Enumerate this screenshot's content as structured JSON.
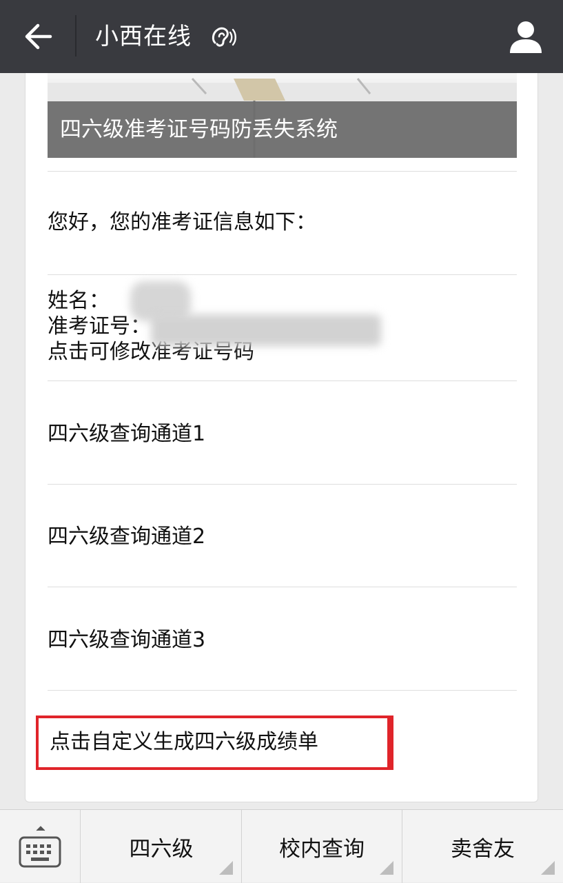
{
  "header": {
    "title": "小西在线",
    "back_icon": "arrow-left-icon",
    "listen_icon": "ear-icon",
    "profile_icon": "person-icon"
  },
  "banner": {
    "title": "四六级准考证号码防丢失系统"
  },
  "content": {
    "greeting": "您好，您的准考证信息如下：",
    "name_label": "姓名：",
    "ticket_label": "准考证号：",
    "edit_link": "点击可修改准考证号码",
    "channels": [
      {
        "label": "四六级查询通道1"
      },
      {
        "label": "四六级查询通道2"
      },
      {
        "label": "四六级查询通道3"
      }
    ],
    "custom_report": "点击自定义生成四六级成绩单",
    "highlight_color": "#e0242a"
  },
  "bottom_menu": {
    "keyboard_icon": "keyboard-icon",
    "tabs": [
      {
        "label": "四六级"
      },
      {
        "label": "校内查询"
      },
      {
        "label": "卖舍友"
      }
    ]
  }
}
